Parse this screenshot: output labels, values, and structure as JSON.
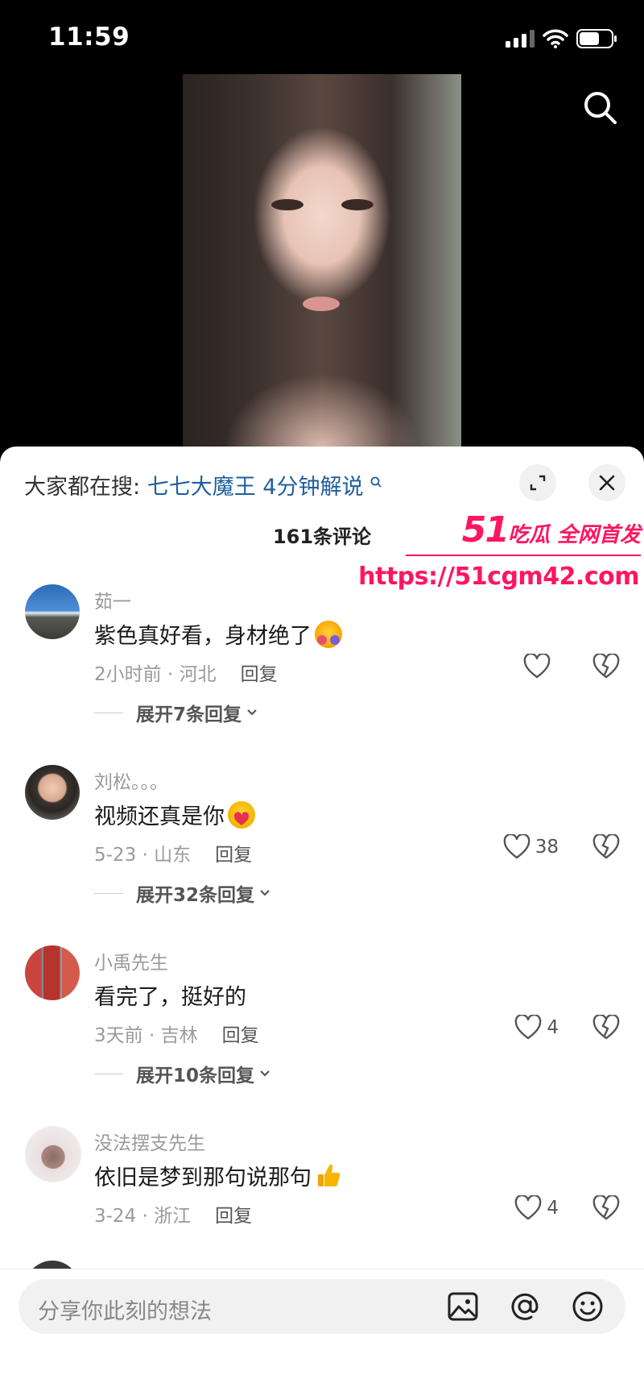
{
  "status_bar": {
    "time": "11:59"
  },
  "sheet": {
    "search_prefix": "大家都在搜:",
    "search_query": "七七大魔王 4分钟解说",
    "comment_count": "161条评论"
  },
  "watermark": {
    "brand_num": "51",
    "brand_text": "吃瓜 全网首发",
    "url": "https://51cgm42.com"
  },
  "comments": [
    {
      "name": "茹一",
      "text": "紫色真好看，身材绝了",
      "meta": "2小时前 · 河北",
      "reply": "回复",
      "likes": "",
      "expand": "展开7条回复"
    },
    {
      "name": "刘松。。。",
      "text": "视频还真是你",
      "meta": "5-23 · 山东",
      "reply": "回复",
      "likes": "38",
      "expand": "展开32条回复"
    },
    {
      "name": "小禹先生",
      "text": "看完了，挺好的",
      "meta": "3天前 · 吉林",
      "reply": "回复",
      "likes": "4",
      "expand": "展开10条回复"
    },
    {
      "name": "没法摆支先生",
      "text": "依旧是梦到那句说那句",
      "meta": "3-24 · 浙江",
      "reply": "回复",
      "likes": "4",
      "expand": ""
    }
  ],
  "input": {
    "placeholder": "分享你此刻的想法"
  }
}
